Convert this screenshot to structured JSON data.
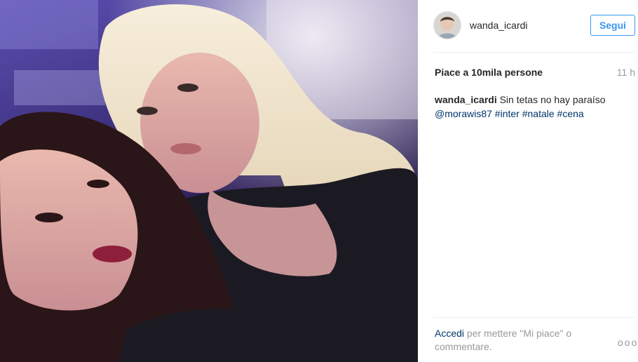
{
  "post": {
    "author": "wanda_icardi",
    "follow_label": "Segui",
    "likes": "Piace a 10mila persone",
    "time_ago": "11 h",
    "caption": {
      "username": "wanda_icardi",
      "text": "Sin tetas no hay paraíso",
      "mention": "@morawis87",
      "hashtags": [
        "#inter",
        "#natale",
        "#cena"
      ]
    },
    "login_prompt": {
      "link": "Accedi",
      "text": "per mettere \"Mi piace\" o commentare."
    },
    "more_label": "ooo"
  },
  "icons": {
    "more": "more-options-icon"
  },
  "colors": {
    "accent": "#3897f0",
    "link": "#003569",
    "muted": "#999999",
    "text": "#262626"
  }
}
